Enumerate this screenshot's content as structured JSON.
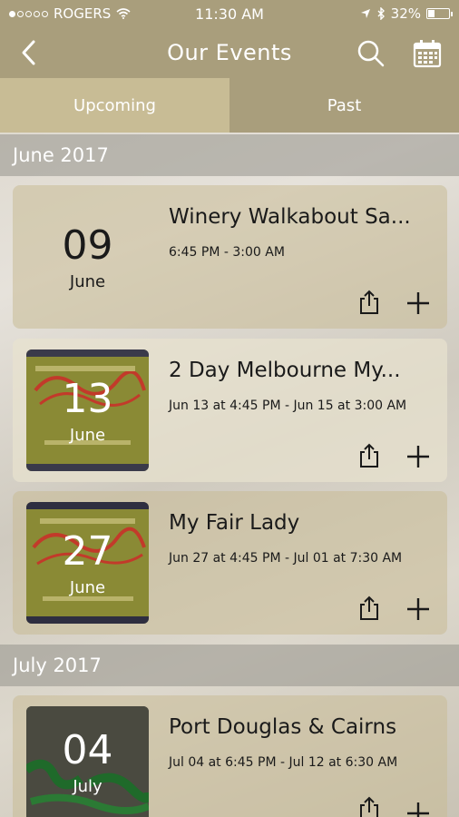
{
  "status": {
    "carrier": "ROGERS",
    "time": "11:30 AM",
    "battery": "32%",
    "battery_level": 0.32
  },
  "nav": {
    "title": "Our Events",
    "back_icon": "chevron-left-icon",
    "search_icon": "search-icon",
    "calendar_icon": "calendar-icon"
  },
  "tabs": [
    {
      "label": "Upcoming",
      "active": true
    },
    {
      "label": "Past",
      "active": false
    }
  ],
  "sections": [
    {
      "header": "June 2017",
      "events": [
        {
          "day": "09",
          "month": "June",
          "title": "Winery Walkabout Sa...",
          "time": "6:45 PM - 3:00 AM",
          "has_image": false
        },
        {
          "day": "13",
          "month": "June",
          "title": "2 Day Melbourne My...",
          "time": "Jun 13 at 4:45 PM - Jun 15 at 3:00 AM",
          "has_image": true
        },
        {
          "day": "27",
          "month": "June",
          "title": "My Fair Lady",
          "time": "Jun 27 at 4:45 PM - Jul 01 at 7:30 AM",
          "has_image": true
        }
      ]
    },
    {
      "header": "July 2017",
      "events": [
        {
          "day": "04",
          "month": "July",
          "title": "Port Douglas & Cairns",
          "time": "Jul 04 at 6:45 PM - Jul 12 at 6:30 AM",
          "has_image": true
        }
      ]
    }
  ],
  "colors": {
    "nav_bg": "#a99e7c",
    "tab_active_bg": "#c8bc95",
    "text_dark": "#1a1a1a"
  }
}
